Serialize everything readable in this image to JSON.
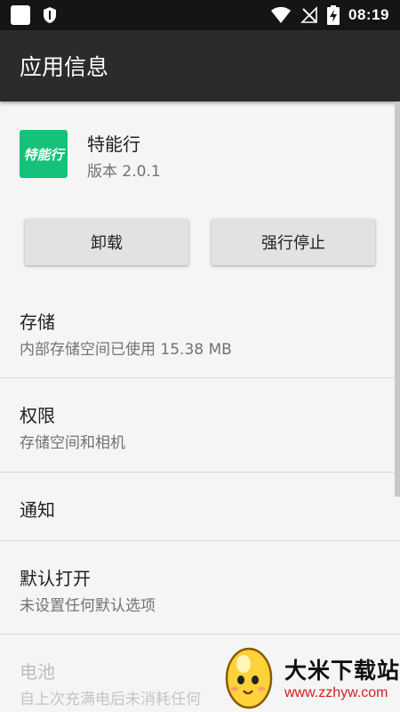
{
  "status_bar": {
    "time": "08:19",
    "icons": [
      "app-notification-icon",
      "shield-icon",
      "wifi-icon",
      "no-signal-icon",
      "battery-charging-icon"
    ]
  },
  "app_bar": {
    "title": "应用信息"
  },
  "app": {
    "name": "特能行",
    "icon_text": "特能行",
    "version": "版本 2.0.1",
    "icon_color": "#16c27a"
  },
  "buttons": {
    "uninstall": "卸载",
    "force_stop": "强行停止"
  },
  "items": [
    {
      "title": "存储",
      "summary": "内部存储空间已使用 15.38 MB"
    },
    {
      "title": "权限",
      "summary": "存储空间和相机"
    },
    {
      "title": "通知",
      "summary": ""
    },
    {
      "title": "默认打开",
      "summary": "未设置任何默认选项"
    },
    {
      "title": "电池",
      "summary": "自上次充满电后未消耗任何"
    }
  ],
  "watermark": {
    "title": "大米下载站",
    "url": "www.zzhyw.com"
  },
  "colors": {
    "app_bar": "#2b2b2b",
    "status_bar": "#151515",
    "background": "#f5f5f5",
    "watermark_url": "#d42020"
  }
}
